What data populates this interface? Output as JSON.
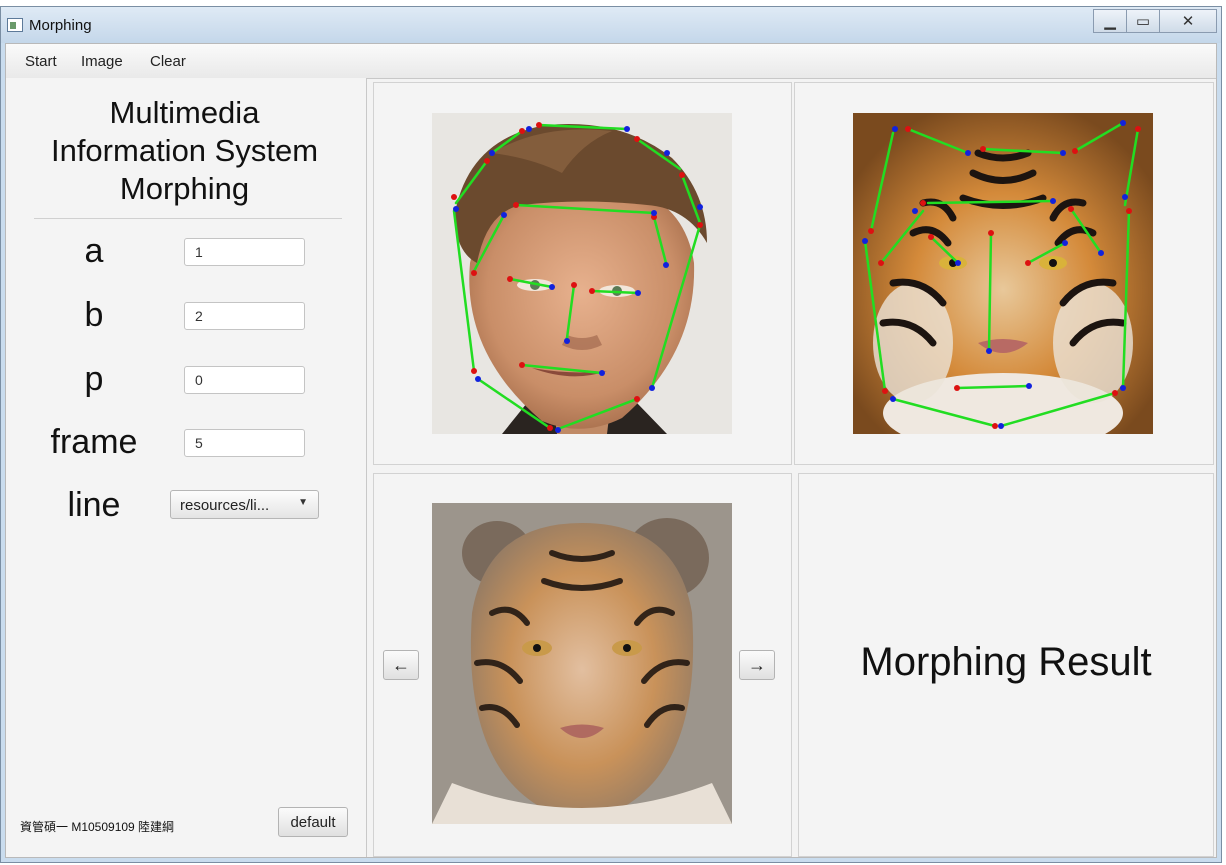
{
  "window": {
    "title": "Morphing"
  },
  "menu": [
    "Start",
    "Image",
    "Clear"
  ],
  "left_panel": {
    "title_lines": [
      "Multimedia",
      "Information System",
      "Morphing"
    ],
    "params": [
      {
        "label": "a",
        "value": "1"
      },
      {
        "label": "b",
        "value": "2"
      },
      {
        "label": "p",
        "value": "0"
      },
      {
        "label": "frame",
        "value": "5"
      }
    ],
    "line": {
      "label": "line",
      "selected": "resources/li..."
    },
    "credit": "資管碩一 M10509109 陸建綱",
    "default_button": "default"
  },
  "nav": {
    "prev_label": "←",
    "next_label": "→"
  },
  "result_label": "Morphing Result",
  "colors": {
    "line": "#22dd22",
    "point_a": "#dd1111",
    "point_b": "#1122dd"
  }
}
